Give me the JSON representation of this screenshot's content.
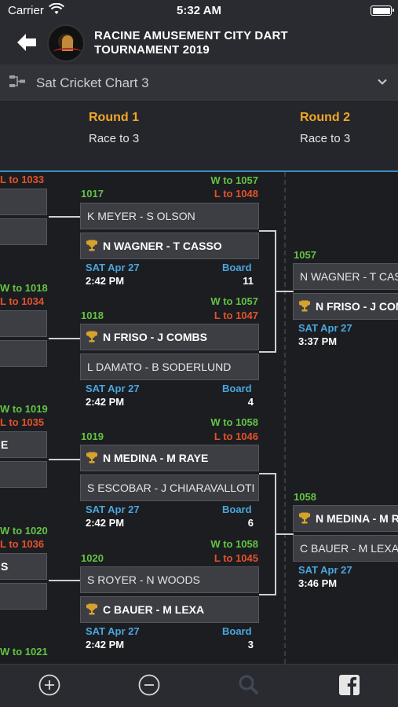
{
  "status": {
    "carrier": "Carrier",
    "time": "5:32 AM"
  },
  "header": {
    "title_line1": "RACINE AMUSEMENT CITY DART",
    "title_line2": "TOURNAMENT 2019"
  },
  "selector": {
    "value": "Sat Cricket Chart 3"
  },
  "rounds": [
    {
      "name": "Round 1",
      "subtitle": "Race to 3"
    },
    {
      "name": "Round 2",
      "subtitle": "Race to 3"
    }
  ],
  "left_column": {
    "labels": [
      "L to 1033",
      "W to 1018",
      "L to 1034",
      "W to 1019",
      "L to 1035",
      "W to 1020",
      "L to 1036",
      "W to 1021"
    ],
    "box_texts": [
      "E",
      "S"
    ]
  },
  "matches": [
    {
      "id": "1017",
      "w_to": "W to 1057",
      "l_to": "L to 1048",
      "team1": "K MEYER - S OLSON",
      "team2": "N WAGNER - T CASSO",
      "winner": 2,
      "date": "SAT Apr 27",
      "time": "2:42 PM",
      "board_label": "Board",
      "board": "11"
    },
    {
      "id": "1018",
      "w_to": "W to 1057",
      "l_to": "L to 1047",
      "team1": "N FRISO - J COMBS",
      "team2": "L DAMATO - B SODERLUND",
      "winner": 1,
      "date": "SAT Apr 27",
      "time": "2:42 PM",
      "board_label": "Board",
      "board": "4"
    },
    {
      "id": "1019",
      "w_to": "W to 1058",
      "l_to": "L to 1046",
      "team1": "N MEDINA - M RAYE",
      "team2": "S ESCOBAR - J CHIARAVALLOTI",
      "winner": 1,
      "date": "SAT Apr 27",
      "time": "2:42 PM",
      "board_label": "Board",
      "board": "6"
    },
    {
      "id": "1020",
      "w_to": "W to 1058",
      "l_to": "L to 1045",
      "team1": "S ROYER - N WOODS",
      "team2": "C BAUER - M LEXA",
      "winner": 2,
      "date": "SAT Apr 27",
      "time": "2:42 PM",
      "board_label": "Board",
      "board": "3"
    }
  ],
  "round2": [
    {
      "id": "1057",
      "team1": "N WAGNER - T CASSO",
      "team2": "N FRISO - J COMBS",
      "winner": 2,
      "date": "SAT Apr 27",
      "time": "3:37 PM"
    },
    {
      "id": "1058",
      "team1": "N MEDINA - M RAYE",
      "team2": "C BAUER - M LEXA",
      "winner": 1,
      "date": "SAT Apr 27",
      "time": "3:46 PM"
    }
  ],
  "toolbar": {
    "icons": [
      "zoom-in-icon",
      "zoom-out-icon",
      "search-icon",
      "facebook-icon"
    ]
  },
  "colors": {
    "accent_orange": "#f2a626",
    "win_green": "#62c443",
    "loss_red": "#e2532b",
    "info_blue": "#4aa6de",
    "divider_blue": "#3b8ec2"
  }
}
